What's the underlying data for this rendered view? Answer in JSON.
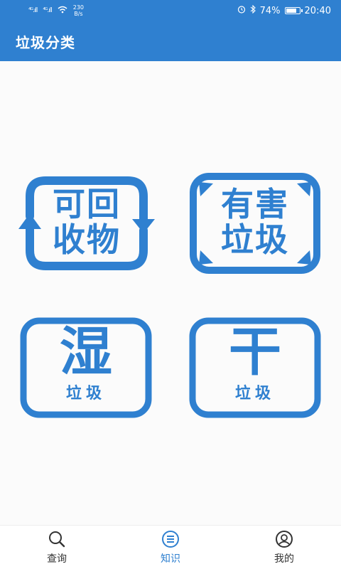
{
  "status_bar": {
    "signal1": "⁴ᴳ.ıll",
    "signal2": "⁴ᴳ.ıll",
    "speed_value": "230",
    "speed_unit": "B/s",
    "battery_pct": "74%",
    "time": "20:40"
  },
  "app": {
    "title": "垃圾分类"
  },
  "categories": {
    "recyclable": {
      "line1": "可回",
      "line2": "收物"
    },
    "hazardous": {
      "line1": "有害",
      "line2": "垃圾"
    },
    "wet": {
      "main": "湿",
      "sub": "垃圾"
    },
    "dry": {
      "main": "干",
      "sub": "垃圾"
    }
  },
  "tabs": [
    {
      "label": "查询",
      "icon": "search-icon"
    },
    {
      "label": "知识",
      "icon": "knowledge-icon"
    },
    {
      "label": "我的",
      "icon": "profile-icon"
    }
  ],
  "active_tab": 1,
  "colors": {
    "accent": "#2f80d0",
    "text": "#333333"
  }
}
